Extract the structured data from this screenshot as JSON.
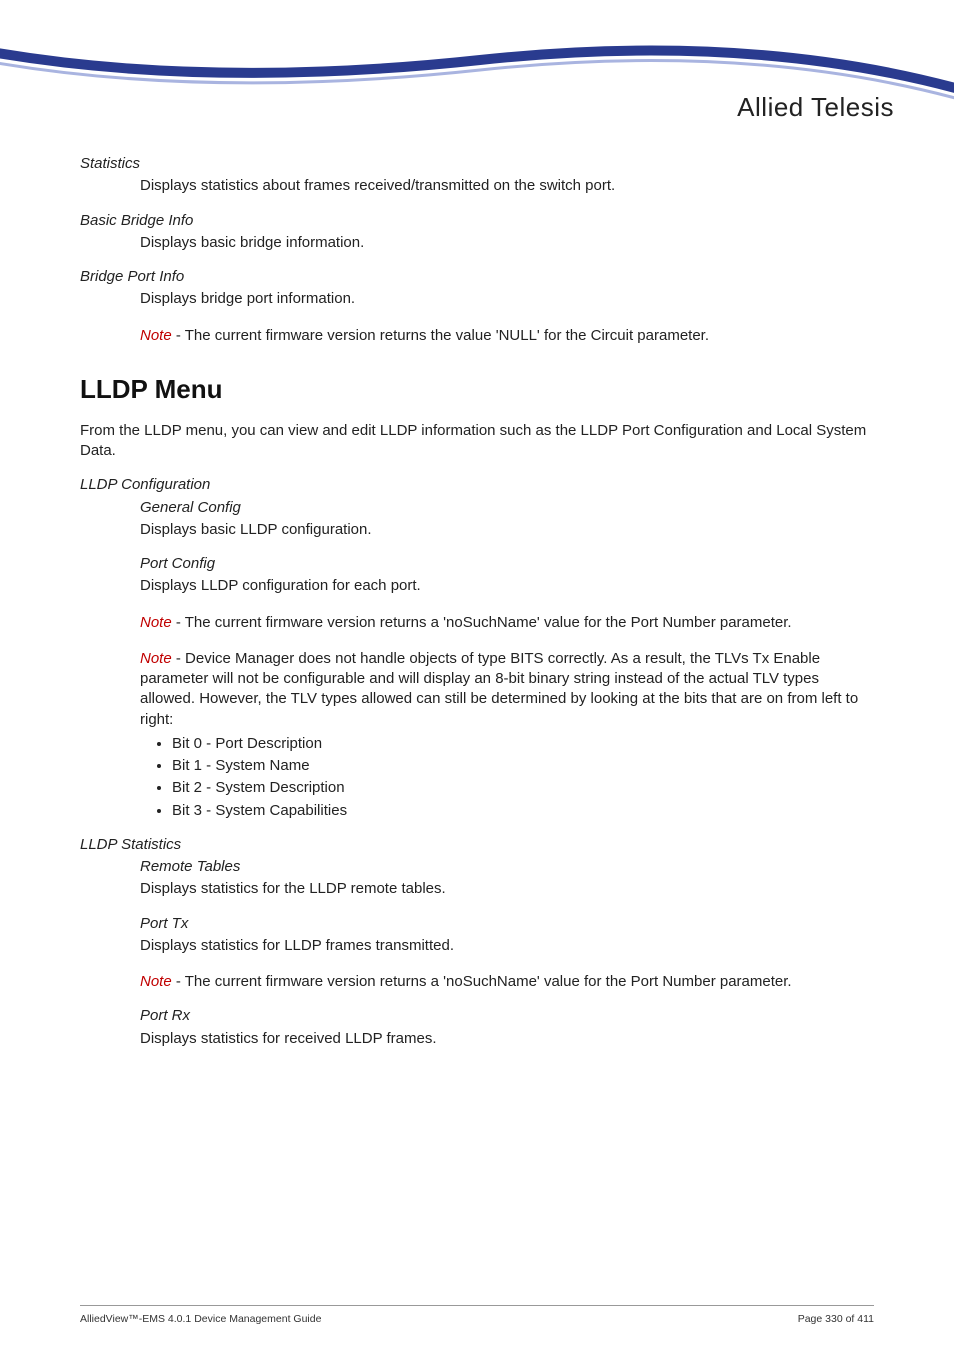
{
  "logo": {
    "brand": "Allied Telesis"
  },
  "sections": {
    "statistics": {
      "title": "Statistics",
      "desc": "Displays statistics about frames received/transmitted on the switch port."
    },
    "basic_bridge": {
      "title": "Basic Bridge Info",
      "desc": "Displays basic bridge information."
    },
    "bridge_port": {
      "title": "Bridge Port Info",
      "desc": "Displays bridge port information.",
      "note_label": "Note",
      "note_body": " - The current firmware version returns the value 'NULL' for the Circuit parameter."
    },
    "lldp_menu": {
      "heading": "LLDP Menu",
      "intro": "From the LLDP menu, you can view and edit LLDP information such as the LLDP Port Configuration and Local System Data."
    },
    "lldp_config": {
      "title": "LLDP Configuration",
      "general": {
        "title": "General Config",
        "desc": "Displays basic LLDP configuration."
      },
      "port": {
        "title": "Port Config",
        "desc": "Displays LLDP configuration for each port.",
        "note1_label": "Note",
        "note1_body": " - The current firmware version returns a 'noSuchName' value for the Port Number parameter.",
        "note2_label": "Note",
        "note2_body": " - Device Manager does not handle objects of type BITS correctly. As a result, the TLVs Tx Enable parameter will not be configurable and will display an 8-bit binary string instead of the actual TLV types allowed. However, the TLV types allowed can still be determined by looking at the bits that are on from left to right:",
        "bits": [
          "Bit 0 - Port Description",
          "Bit 1 - System Name",
          "Bit 2 - System Description",
          "Bit 3 - System Capabilities"
        ]
      }
    },
    "lldp_stats": {
      "title": "LLDP Statistics",
      "remote": {
        "title": "Remote Tables",
        "desc": "Displays statistics for the LLDP remote tables."
      },
      "port_tx": {
        "title": "Port Tx",
        "desc": "Displays statistics for LLDP frames transmitted.",
        "note_label": "Note",
        "note_body": " - The current firmware version returns a 'noSuchName' value for the Port Number parameter."
      },
      "port_rx": {
        "title": "Port Rx",
        "desc": "Displays statistics for received LLDP frames."
      }
    }
  },
  "footer": {
    "left": "AlliedView™-EMS 4.0.1 Device Management Guide",
    "right": "Page 330 of 411"
  }
}
